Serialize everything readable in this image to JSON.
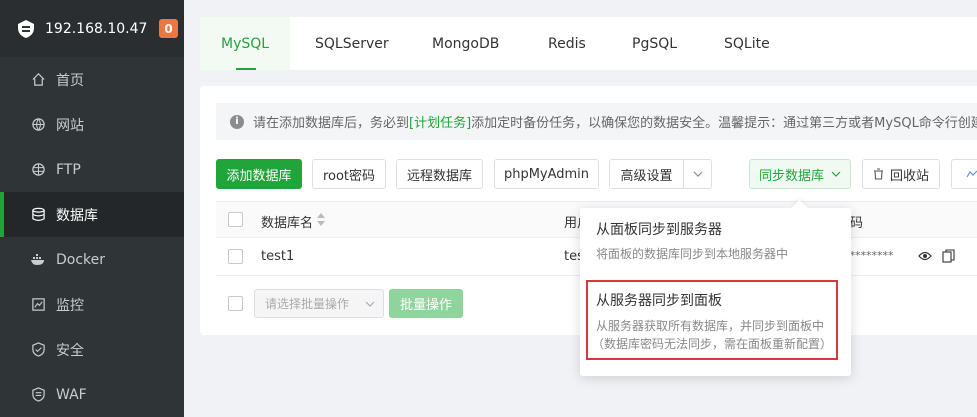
{
  "sidebar": {
    "ip": "192.168.10.47",
    "badge": "0",
    "items": [
      {
        "label": "首页",
        "icon": "home-icon"
      },
      {
        "label": "网站",
        "icon": "globe-icon"
      },
      {
        "label": "FTP",
        "icon": "ftp-globe-icon"
      },
      {
        "label": "数据库",
        "icon": "database-icon"
      },
      {
        "label": "Docker",
        "icon": "docker-icon"
      },
      {
        "label": "监控",
        "icon": "monitor-icon"
      },
      {
        "label": "安全",
        "icon": "shield-icon"
      },
      {
        "label": "WAF",
        "icon": "waf-shield-icon"
      }
    ],
    "active_index": 3
  },
  "tabs": [
    "MySQL",
    "SQLServer",
    "MongoDB",
    "Redis",
    "PgSQL",
    "SQLite"
  ],
  "notice": {
    "before": "请在添加数据库后，务必到",
    "link": "[计划任务]",
    "after": "添加定时备份任务，以确保您的数据安全。温馨提示：通过第三方或者MySQL命令行创建"
  },
  "toolbar": {
    "add_db": "添加数据库",
    "root_password": "root密码",
    "remote_db": "远程数据库",
    "phpmyadmin": "phpMyAdmin",
    "advanced": "高级设置",
    "sync_db": "同步数据库",
    "recycle_bin": "回收站"
  },
  "table": {
    "headers": {
      "name": "数据库名",
      "user": "用户",
      "password": "码"
    },
    "rows": [
      {
        "name": "test1",
        "user": "tes",
        "password": "*********"
      }
    ]
  },
  "batch": {
    "placeholder": "请选择批量操作",
    "action": "批量操作"
  },
  "dropdown": {
    "option1_title": "从面板同步到服务器",
    "option1_desc": "将面板的数据库同步到本地服务器中",
    "option2_title": "从服务器同步到面板",
    "option2_desc1": "从服务器获取所有数据库，并同步到面板中",
    "option2_desc2": "（数据库密码无法同步，需在面板重新配置）"
  },
  "colors": {
    "brand": "#20a53a",
    "sidebar_bg": "#2f3437",
    "badge": "#f0763b",
    "highlight": "#d9363e"
  }
}
